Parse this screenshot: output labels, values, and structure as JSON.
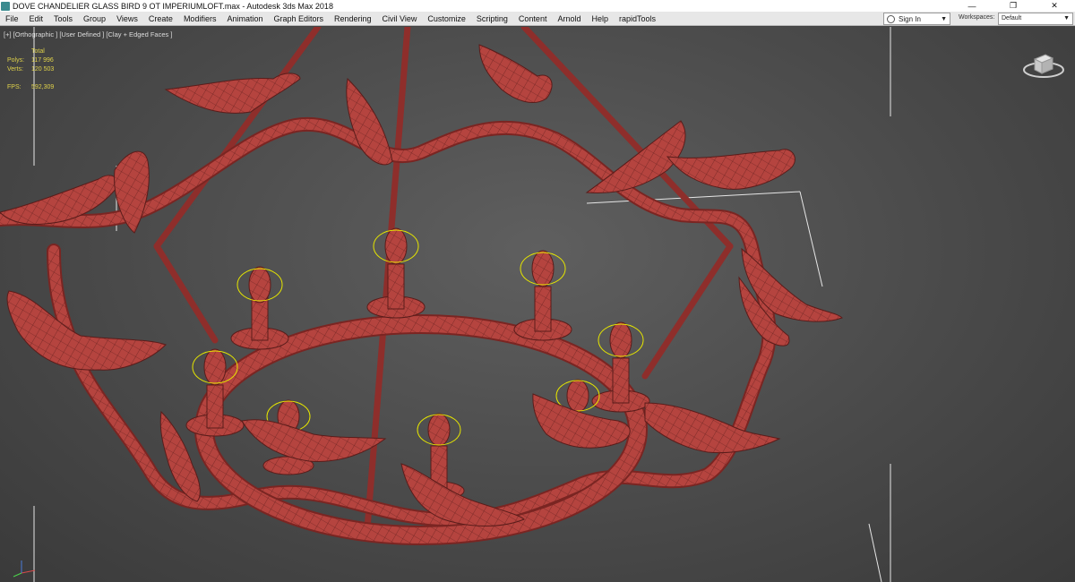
{
  "window": {
    "title": "DOVE CHANDELIER GLASS BIRD 9 OT IMPERIUMLOFT.max - Autodesk 3ds Max 2018",
    "controls": [
      "—",
      "❐",
      "✕"
    ]
  },
  "menubar": {
    "items": [
      "File",
      "Edit",
      "Tools",
      "Group",
      "Views",
      "Create",
      "Modifiers",
      "Animation",
      "Graph Editors",
      "Rendering",
      "Civil View",
      "Customize",
      "Scripting",
      "Content",
      "Arnold",
      "Help",
      "rapidTools"
    ],
    "signin": "Sign In",
    "workspaces_label": "Workspaces:",
    "workspaces_value": "Default"
  },
  "viewport": {
    "label": "[+] [Orthographic ] [User Defined ] [Clay + Edged Faces ]",
    "stats": {
      "total_label": "Total",
      "polys_label": "Polys:",
      "polys_value": "117 996",
      "verts_label": "Verts:",
      "verts_value": "120 503",
      "fps_label": "FPS:",
      "fps_value": "592,309"
    }
  },
  "colors": {
    "model": "#b5443f",
    "model_dark": "#7a2522",
    "wire": "#4a1816",
    "gizmo": "#e6e600",
    "background": "#4f4f4f"
  }
}
